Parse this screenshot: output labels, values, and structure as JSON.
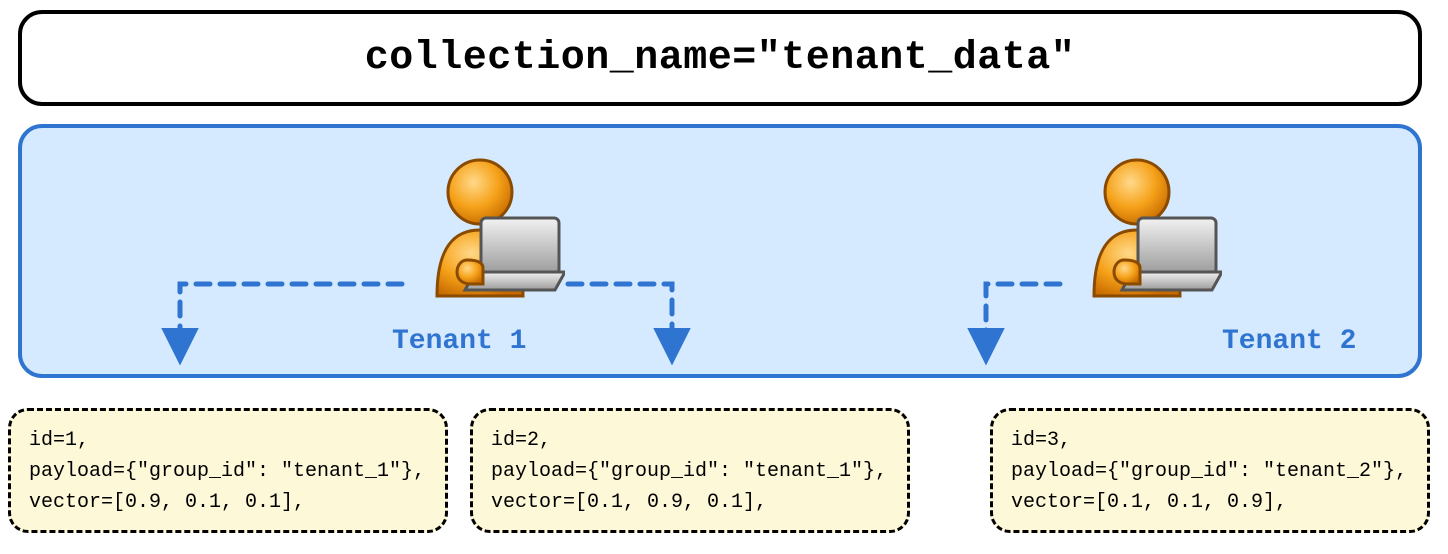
{
  "title": "collection_name=\"tenant_data\"",
  "tenants": [
    {
      "label": "Tenant 1"
    },
    {
      "label": "Tenant 2"
    }
  ],
  "records": [
    {
      "line1": "id=1,",
      "line2": "payload={\"group_id\": \"tenant_1\"},",
      "line3": "vector=[0.9, 0.1, 0.1],"
    },
    {
      "line1": "id=2,",
      "line2": "payload={\"group_id\": \"tenant_1\"},",
      "line3": "vector=[0.1, 0.9, 0.1],"
    },
    {
      "line1": "id=3,",
      "line2": "payload={\"group_id\": \"tenant_2\"},",
      "line3": "vector=[0.1, 0.1, 0.9],"
    }
  ],
  "colors": {
    "accent": "#2f74d0",
    "stageBg": "#d6eaff",
    "recordBg": "#fdf8d7"
  }
}
